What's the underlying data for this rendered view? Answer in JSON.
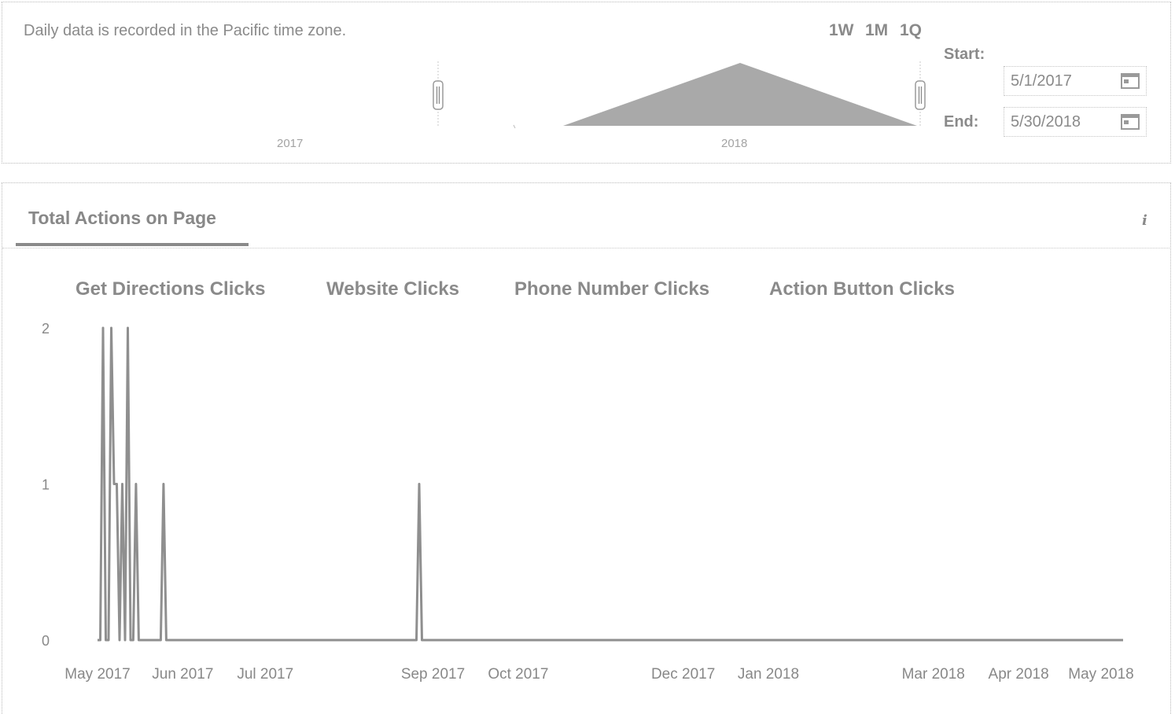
{
  "range_panel": {
    "note": "Daily data is recorded in the Pacific time zone.",
    "range_buttons": [
      "1W",
      "1M",
      "1Q"
    ],
    "overview_years": [
      "2017",
      "2018"
    ],
    "start_label": "Start:",
    "start_value": "5/1/2017",
    "end_label": "End:",
    "end_value": "5/30/2018"
  },
  "card": {
    "title": "Total Actions on Page",
    "info_icon": "info-icon"
  },
  "colors": {
    "line": "#8f8f8f",
    "text": "#8a8a8a",
    "overview_fill": "#a9a9a9"
  },
  "chart_data": {
    "type": "line",
    "title": "",
    "xlabel": "",
    "ylabel": "",
    "legend": [
      "Get Directions Clicks",
      "Website Clicks",
      "Phone Number Clicks",
      "Action Button Clicks"
    ],
    "legend_placement": "top",
    "x_tick_labels": [
      "May 2017",
      "Jun 2017",
      "Jul 2017",
      "Sep 2017",
      "Oct 2017",
      "Dec 2017",
      "Jan 2018",
      "Mar 2018",
      "Apr 2018",
      "May 2018"
    ],
    "x_tick_dates": [
      "2017-05-01",
      "2017-06-01",
      "2017-07-01",
      "2017-08-31",
      "2017-10-01",
      "2017-11-30",
      "2017-12-31",
      "2018-03-01",
      "2018-04-01",
      "2018-05-01"
    ],
    "y_ticks": [
      0,
      1,
      2
    ],
    "ylim": [
      0,
      2
    ],
    "grid": false,
    "series": [
      {
        "x": [
          "2017-05-01",
          "2017-05-02",
          "2017-05-03",
          "2017-05-04",
          "2017-05-05",
          "2017-05-06",
          "2017-05-07",
          "2017-05-08",
          "2017-05-09",
          "2017-05-10",
          "2017-05-11",
          "2017-05-12",
          "2017-05-13",
          "2017-05-14",
          "2017-05-15",
          "2017-05-16",
          "2017-05-17",
          "2017-05-18",
          "2017-05-19",
          "2017-05-20",
          "2017-05-21",
          "2017-05-22",
          "2017-05-23",
          "2017-05-24",
          "2017-05-25",
          "2017-05-26",
          "2017-05-27",
          "2017-05-28",
          "2017-05-29",
          "2017-05-30",
          "2017-05-31",
          "2017-06-01",
          "2017-06-02",
          "2017-06-10",
          "2017-06-11",
          "2017-06-12",
          "2017-06-13",
          "2017-06-14",
          "2017-06-30",
          "2017-07-01",
          "2017-07-02",
          "2017-07-03",
          "2017-07-04",
          "2017-07-05",
          "2017-08-25",
          "2017-08-26",
          "2017-08-27",
          "2017-09-09",
          "2017-09-10",
          "2017-09-11",
          "2017-09-12",
          "2017-09-13",
          "2017-09-14",
          "2017-10-14",
          "2017-10-15",
          "2017-10-16",
          "2017-10-22",
          "2017-10-23",
          "2017-10-24",
          "2017-10-25",
          "2017-10-26",
          "2017-10-27",
          "2017-10-28",
          "2017-10-29",
          "2017-10-30",
          "2017-10-31",
          "2017-11-01",
          "2017-11-02",
          "2017-11-03",
          "2017-11-04",
          "2017-11-05",
          "2017-11-25",
          "2017-11-26",
          "2017-11-27",
          "2017-12-27",
          "2017-12-28",
          "2017-12-29",
          "2018-03-12",
          "2018-03-13",
          "2018-03-14",
          "2018-03-15",
          "2018-03-16",
          "2018-05-07",
          "2018-05-08",
          "2018-05-09"
        ],
        "values": [
          0,
          0,
          2,
          0,
          0,
          2,
          1,
          1,
          0,
          1,
          0,
          2,
          0,
          0,
          1,
          0,
          0,
          0,
          0,
          0,
          0,
          0,
          0,
          0,
          1,
          0,
          0,
          0,
          0,
          0,
          0,
          0,
          0,
          0,
          0,
          0,
          0,
          0,
          0,
          0,
          0,
          0,
          0,
          0,
          0,
          1,
          0,
          0,
          0,
          0,
          0,
          0,
          0,
          0,
          0,
          0,
          0,
          0,
          0,
          0,
          0,
          0,
          0,
          0,
          0,
          0,
          0,
          0,
          0,
          0,
          0,
          0,
          0,
          0,
          0,
          0,
          0,
          0,
          0,
          0,
          0,
          0,
          0,
          0,
          0
        ]
      }
    ]
  }
}
